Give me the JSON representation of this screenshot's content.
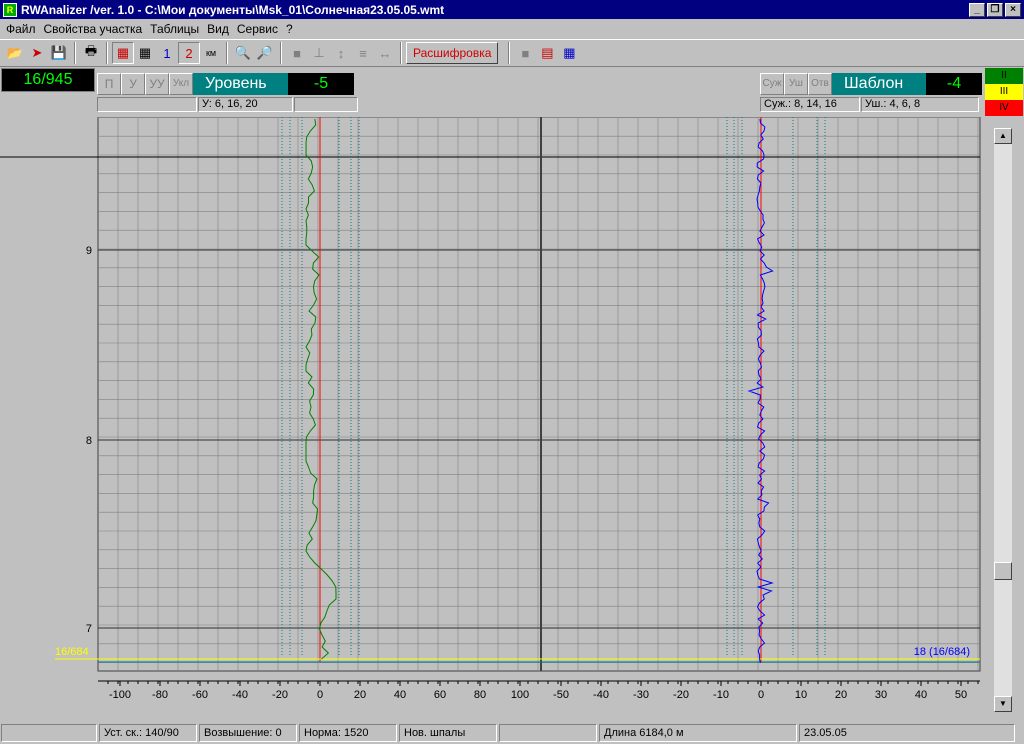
{
  "window": {
    "title": "RWAnalizer /ver. 1.0 - C:\\Мои документы\\Msk_01\\Солнечная23.05.05.wmt"
  },
  "menu": [
    "Файл",
    "Свойства участка",
    "Таблицы",
    "Вид",
    "Сервис",
    "?"
  ],
  "toolbar": {
    "decode_label": "Расшифровка"
  },
  "counter": "16/945",
  "left_panel": {
    "buttons": [
      "П",
      "У",
      "УУ",
      "Укл"
    ],
    "label": "Уровень",
    "value": "-5",
    "info": "У: 6, 16, 20"
  },
  "right_panel": {
    "buttons": [
      "Суж",
      "Уш",
      "Отв"
    ],
    "label": "Шаблон",
    "value": "-4",
    "info1": "Суж.: 8, 14, 16",
    "info2": "Уш.: 4, 6, 8"
  },
  "legend": [
    {
      "text": "II",
      "color": "#008000"
    },
    {
      "text": "III",
      "color": "#ffff00"
    },
    {
      "text": "IV",
      "color": "#ff0000"
    }
  ],
  "chart": {
    "y_ticks": [
      "9",
      "8",
      "7"
    ],
    "left_x_ticks": [
      "-100",
      "-80",
      "-60",
      "-40",
      "-20",
      "0",
      "20",
      "40",
      "60",
      "80",
      "100"
    ],
    "right_x_ticks": [
      "-50",
      "-40",
      "-30",
      "-20",
      "-10",
      "0",
      "10",
      "20",
      "30",
      "40",
      "50"
    ],
    "left_marker": "16/684",
    "right_marker": "18 (16/684)",
    "left_color": "#008000",
    "right_color": "#0000ff",
    "zero_color": "#ff0000",
    "threshold_color": "#008080"
  },
  "status": {
    "speed": "Уст. ск.: 140/90",
    "elevation": "Возвышение: 0",
    "norm": "Норма: 1520",
    "sleepers": "Нов. шпалы",
    "length": "Длина 6184,0 м",
    "date": "23.05.05"
  }
}
